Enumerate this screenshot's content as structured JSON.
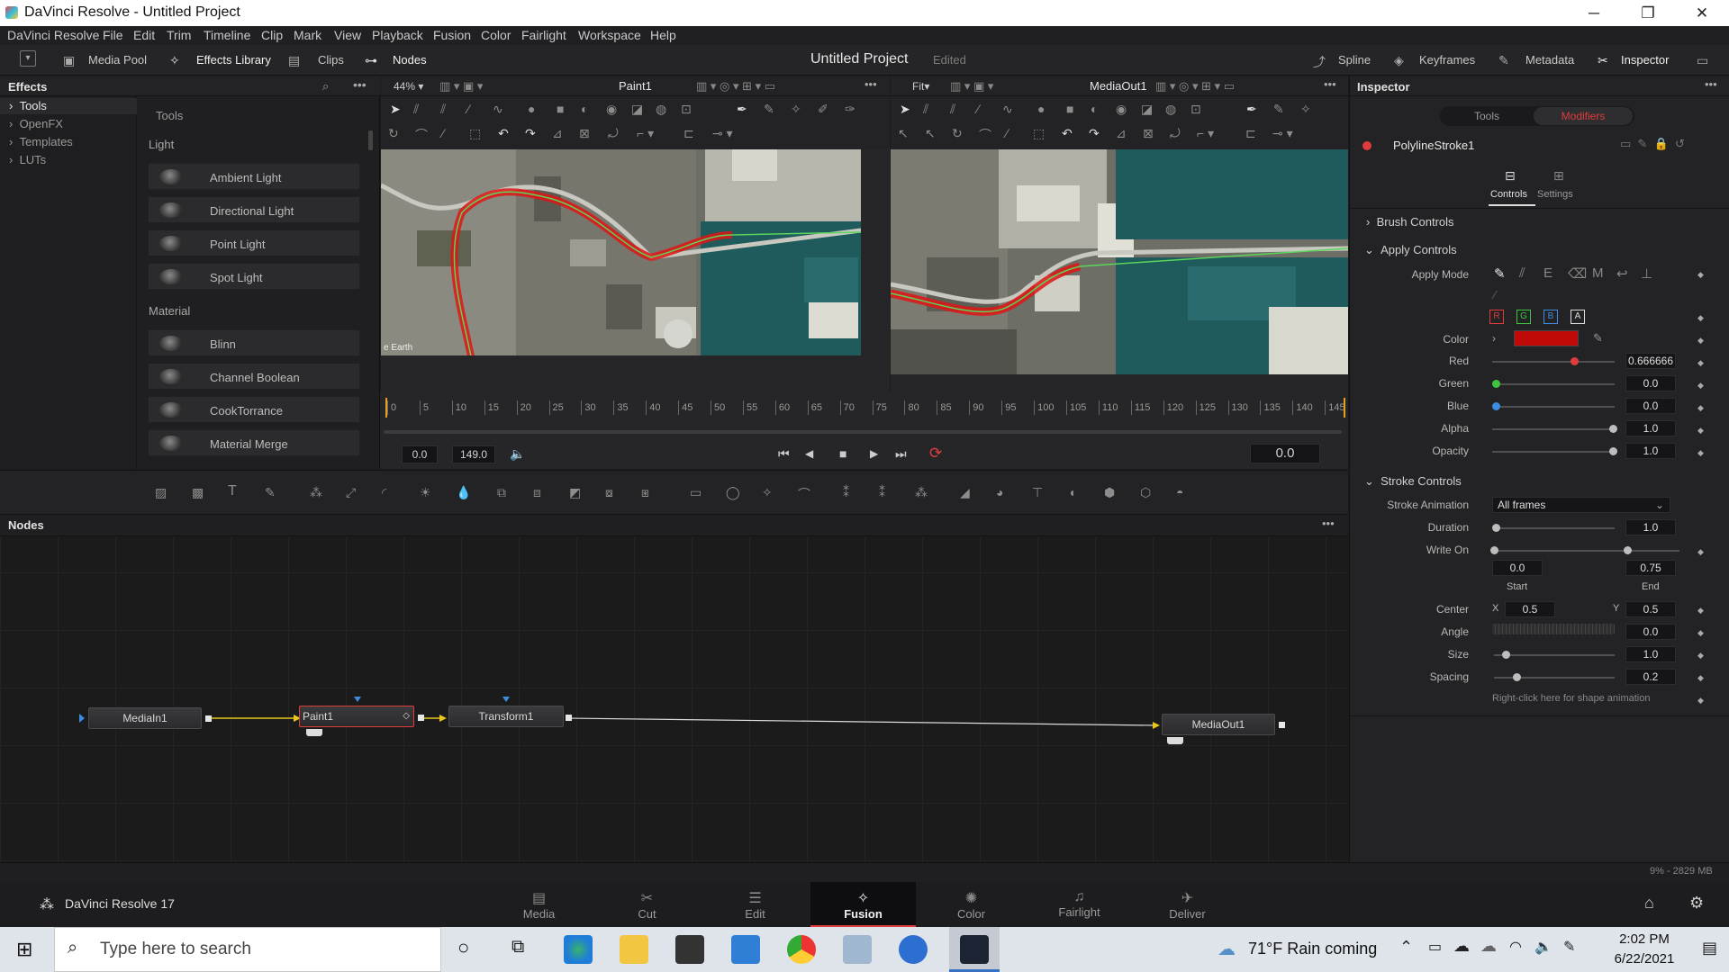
{
  "window": {
    "title": "DaVinci Resolve - Untitled Project",
    "min": "─",
    "max": "❐",
    "close": "✕"
  },
  "menu": [
    "DaVinci Resolve",
    "File",
    "Edit",
    "Trim",
    "Timeline",
    "Clip",
    "Mark",
    "View",
    "Playback",
    "Fusion",
    "Color",
    "Fairlight",
    "Workspace",
    "Help"
  ],
  "toolbar": {
    "media_pool": "Media Pool",
    "effects_library": "Effects Library",
    "clips": "Clips",
    "nodes": "Nodes",
    "project": "Untitled Project",
    "edited": "Edited",
    "spline": "Spline",
    "keyframes": "Keyframes",
    "metadata": "Metadata",
    "inspector": "Inspector"
  },
  "effects": {
    "title": "Effects",
    "tree": [
      "Tools",
      "OpenFX",
      "Templates",
      "LUTs"
    ],
    "tools_header": "Tools",
    "sections": [
      {
        "name": "Light",
        "items": [
          "Ambient Light",
          "Directional Light",
          "Point Light",
          "Spot Light"
        ]
      },
      {
        "name": "Material",
        "items": [
          "Blinn",
          "Channel Boolean",
          "CookTorrance",
          "Material Merge"
        ]
      }
    ]
  },
  "viewer1": {
    "zoom": "44%",
    "name": "Paint1",
    "watermark": "e Earth"
  },
  "viewer2": {
    "zoom": "Fit",
    "name": "MediaOut1"
  },
  "timeline": {
    "ticks": [
      "0",
      "5",
      "10",
      "15",
      "20",
      "25",
      "30",
      "35",
      "40",
      "45",
      "50",
      "55",
      "60",
      "65",
      "70",
      "75",
      "80",
      "85",
      "90",
      "95",
      "100",
      "105",
      "110",
      "115",
      "120",
      "125",
      "130",
      "135",
      "140",
      "145"
    ],
    "start": "0.0",
    "end": "149.0",
    "current": "0.0"
  },
  "nodes_panel": {
    "title": "Nodes",
    "nodes": [
      "MediaIn1",
      "Paint1",
      "Transform1",
      "MediaOut1"
    ]
  },
  "inspector": {
    "title": "Inspector",
    "tabs": [
      "Tools",
      "Modifiers"
    ],
    "tool_name": "PolylineStroke1",
    "subtabs": [
      "Controls",
      "Settings"
    ],
    "sections": {
      "brush": "Brush Controls",
      "apply": "Apply Controls",
      "stroke": "Stroke Controls"
    },
    "apply_mode_label": "Apply Mode",
    "channels": [
      "R",
      "G",
      "B",
      "A"
    ],
    "color_label": "Color",
    "swatch": "#c00a0a",
    "rows": [
      {
        "label": "Red",
        "value": "0.666666",
        "level": 0.666666
      },
      {
        "label": "Green",
        "value": "0.0",
        "level": 0
      },
      {
        "label": "Blue",
        "value": "0.0",
        "level": 0
      },
      {
        "label": "Alpha",
        "value": "1.0",
        "level": 1
      },
      {
        "label": "Opacity",
        "value": "1.0",
        "level": 1
      }
    ],
    "stroke_animation_label": "Stroke Animation",
    "stroke_animation": "All frames",
    "duration_label": "Duration",
    "duration": "1.0",
    "write_on_label": "Write On",
    "write_on_start": "0.0",
    "write_on_end": "0.75",
    "start_label": "Start",
    "end_label": "End",
    "center_label": "Center",
    "x_label": "X",
    "center_x": "0.5",
    "y_label": "Y",
    "center_y": "0.5",
    "angle_label": "Angle",
    "angle": "0.0",
    "size_label": "Size",
    "size": "1.0",
    "spacing_label": "Spacing",
    "spacing": "0.2",
    "hint": "Right-click here for shape animation"
  },
  "status": {
    "app": "DaVinci Resolve 17",
    "memory": "9% - 2829 MB"
  },
  "pages": [
    "Media",
    "Cut",
    "Edit",
    "Fusion",
    "Color",
    "Fairlight",
    "Deliver"
  ],
  "active_page": "Fusion",
  "taskbar": {
    "search_placeholder": "Type here to search",
    "weather": "71°F  Rain coming",
    "time": "2:02 PM",
    "date": "6/22/2021"
  }
}
